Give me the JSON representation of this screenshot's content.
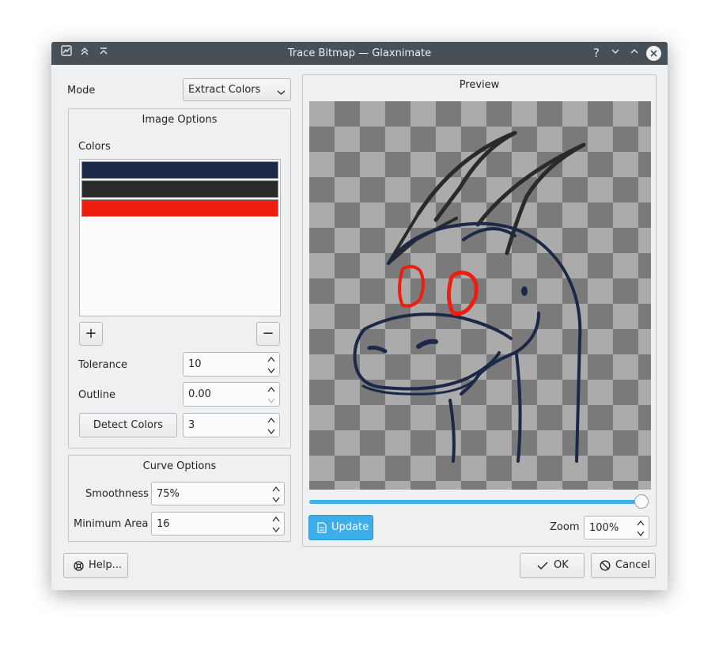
{
  "window": {
    "title": "Trace Bitmap — Glaxnimate"
  },
  "titlebar_icons": [
    "app-icon",
    "keep-above-icon",
    "keep-below-icon"
  ],
  "titlebar_buttons": [
    "help-icon",
    "minimize-icon",
    "maximize-icon",
    "close-icon"
  ],
  "mode": {
    "label": "Mode",
    "value": "Extract Colors"
  },
  "image_options": {
    "title": "Image Options",
    "colors_label": "Colors",
    "colors": [
      "#1c2848",
      "#2a2a2a",
      "#ef1d0d"
    ],
    "add_label": "+",
    "remove_label": "−",
    "tolerance": {
      "label": "Tolerance",
      "value": "10"
    },
    "outline": {
      "label": "Outline",
      "value": "0.00"
    },
    "detect": {
      "label": "Detect Colors",
      "value": "3"
    }
  },
  "curve_options": {
    "title": "Curve Options",
    "smoothness": {
      "label": "Smoothness",
      "value": "75%"
    },
    "min_area": {
      "label": "Minimum Area",
      "value": "16"
    }
  },
  "preview": {
    "title": "Preview",
    "slider_fraction": 1.0,
    "update_label": "Update",
    "zoom_label": "Zoom",
    "zoom_value": "100%"
  },
  "footer": {
    "help_label": "Help...",
    "ok_label": "OK",
    "cancel_label": "Cancel"
  }
}
